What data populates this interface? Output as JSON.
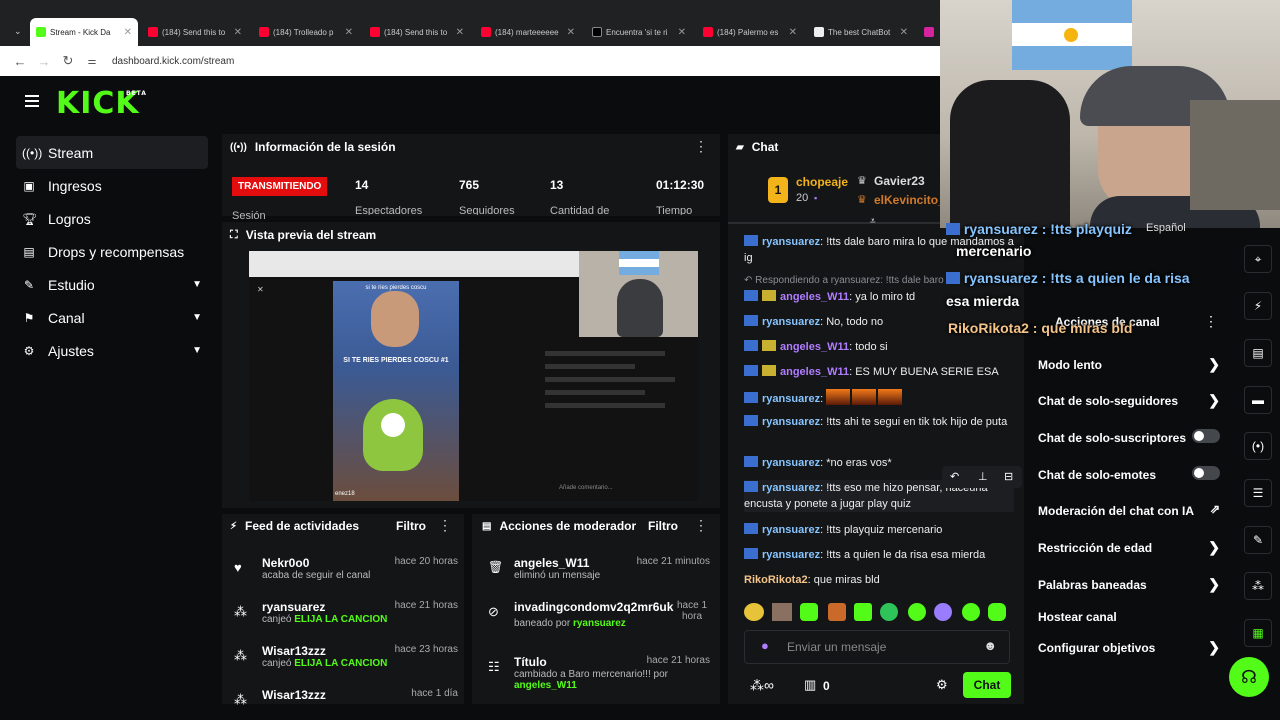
{
  "browser": {
    "tabs": [
      {
        "label": "Stream - Kick Da",
        "color": "#53fc18"
      },
      {
        "label": "(184) Send this to",
        "color": "#ff0033"
      },
      {
        "label": "(184) Trolleado p",
        "color": "#ff0033"
      },
      {
        "label": "(184) Send this to",
        "color": "#ff0033"
      },
      {
        "label": "(184) marteeeeee",
        "color": "#ff0033"
      },
      {
        "label": "Encuentra 'si te ri",
        "color": "#000000"
      },
      {
        "label": "(184) Palermo es",
        "color": "#ff0033"
      },
      {
        "label": "The best ChatBot",
        "color": "#444444"
      }
    ],
    "url": "dashboard.kick.com/stream"
  },
  "kick": {
    "logo": "KICK",
    "beta": "BETA"
  },
  "sidebar": {
    "items": [
      {
        "label": "Stream",
        "icon": "broadcast-icon"
      },
      {
        "label": "Ingresos",
        "icon": "money-icon"
      },
      {
        "label": "Logros",
        "icon": "trophy-icon"
      },
      {
        "label": "Drops y recompensas",
        "icon": "gift-icon"
      },
      {
        "label": "Estudio",
        "icon": "paintbrush-icon"
      },
      {
        "label": "Canal",
        "icon": "flag-icon"
      },
      {
        "label": "Ajustes",
        "icon": "gear-icon"
      }
    ]
  },
  "session": {
    "title": "Información de la sesión",
    "live_badge": "TRANSMITIENDO",
    "stats": [
      {
        "value": "14",
        "label": "Espectadores"
      },
      {
        "value": "765",
        "label": "Seguidores"
      },
      {
        "value": "13",
        "label": "Cantidad de"
      },
      {
        "value": "01:12:30",
        "label": "Tiempo"
      }
    ],
    "truncated_label": "Sesión"
  },
  "preview": {
    "title": "Vista previa del stream",
    "video_caption": "SI TE RIES PIERDES COSCU #1",
    "video_top_caption": "si te ries pierdes coscu",
    "video_user": "enez18",
    "comment_placeholder": "Añade comentario..."
  },
  "activity": {
    "title": "Feed de actividades",
    "filter": "Filtro",
    "items": [
      {
        "name": "Nekr0o0",
        "time": "hace 20 horas",
        "sub": "acaba de seguir el canal",
        "highlight": ""
      },
      {
        "name": "ryansuarez",
        "time": "hace 21 horas",
        "sub": "canjeó",
        "highlight": "ELIJA LA CANCION"
      },
      {
        "name": "Wisar13zzz",
        "time": "hace 23 horas",
        "sub": "canjeó",
        "highlight": "ELIJA LA CANCION"
      },
      {
        "name": "Wisar13zzz",
        "time": "hace 1 día",
        "sub": "",
        "highlight": ""
      }
    ]
  },
  "modactions": {
    "title": "Acciones de moderador",
    "filter": "Filtro",
    "items": [
      {
        "name": "angeles_W11",
        "time": "hace 21 minutos",
        "sub": "eliminó un mensaje",
        "by": ""
      },
      {
        "name": "invadingcondomv2q2mr6uk",
        "time": "hace 1 hora",
        "sub": "baneado por",
        "by": "ryansuarez"
      },
      {
        "name": "Título",
        "time": "hace 21 horas",
        "sub": "cambiado a Baro mercenario!!! por",
        "by": "angeles_W11"
      }
    ]
  },
  "chat": {
    "title": "Chat",
    "top_gifter": {
      "rank": "1",
      "name": "chopeaje",
      "count": "20"
    },
    "gifter2": "Gavier23",
    "gifter3": "elKevincito_",
    "reply_note": "Respondiendo a ryansuarez: !tts dale baro mira lo que",
    "messages": [
      {
        "user": "ryansuarez",
        "text": "!tts dale baro mira lo que mandamos a ig",
        "color": "#86c5ff"
      },
      {
        "user": "angeles_W11",
        "text": "ya lo miro td",
        "color": "#b07dff"
      },
      {
        "user": "ryansuarez",
        "text": "No, todo no",
        "color": "#86c5ff"
      },
      {
        "user": "angeles_W11",
        "text": "todo si",
        "color": "#b07dff"
      },
      {
        "user": "angeles_W11",
        "text": "ES MUY BUENA SERIE ESA",
        "color": "#b07dff"
      },
      {
        "user": "ryansuarez",
        "text": "",
        "color": "#86c5ff"
      },
      {
        "user": "ryansuarez",
        "text": "!tts ahi te segui en tik tok hijo de puta",
        "color": "#86c5ff"
      },
      {
        "user": "ryansuarez",
        "text": "*no eras vos*",
        "color": "#86c5ff"
      },
      {
        "user": "ryansuarez",
        "text": "!tts eso me hizo pensar, haceuna encusta y ponete a jugar play quiz",
        "color": "#86c5ff"
      },
      {
        "user": "ryansuarez",
        "text": "!tts playquiz mercenario",
        "color": "#86c5ff"
      },
      {
        "user": "ryansuarez",
        "text": "!tts a quien le da risa esa mierda",
        "color": "#86c5ff"
      },
      {
        "user": "RikoRikota2",
        "text": "que miras bld",
        "color": "#f4c48a"
      }
    ],
    "input_placeholder": "Enviar un mensaje",
    "send_label": "Chat",
    "points": "0"
  },
  "settings": {
    "title": "Acciones de canal",
    "rows": [
      {
        "label": "Modo lento",
        "kind": "arrow"
      },
      {
        "label": "Chat de solo-seguidores",
        "kind": "arrow"
      },
      {
        "label": "Chat de solo-suscriptores",
        "kind": "toggle"
      },
      {
        "label": "Chat de solo-emotes",
        "kind": "toggle"
      },
      {
        "label": "Moderación del chat con IA",
        "kind": "link"
      },
      {
        "label": "Restricción de edad",
        "kind": "arrow"
      },
      {
        "label": "Palabras baneadas",
        "kind": "arrow"
      },
      {
        "label": "Hostear canal",
        "kind": "none"
      },
      {
        "label": "Configurar objetivos",
        "kind": "arrow"
      }
    ]
  },
  "overlay": {
    "line1": "ryansuarez : !tts playquiz",
    "lang": "Español",
    "line2": "mercenario",
    "line3": "ryansuarez : !tts a quien le da risa",
    "line4": "esa mierda",
    "line5": "RikoRikota2 : que miras bld"
  }
}
